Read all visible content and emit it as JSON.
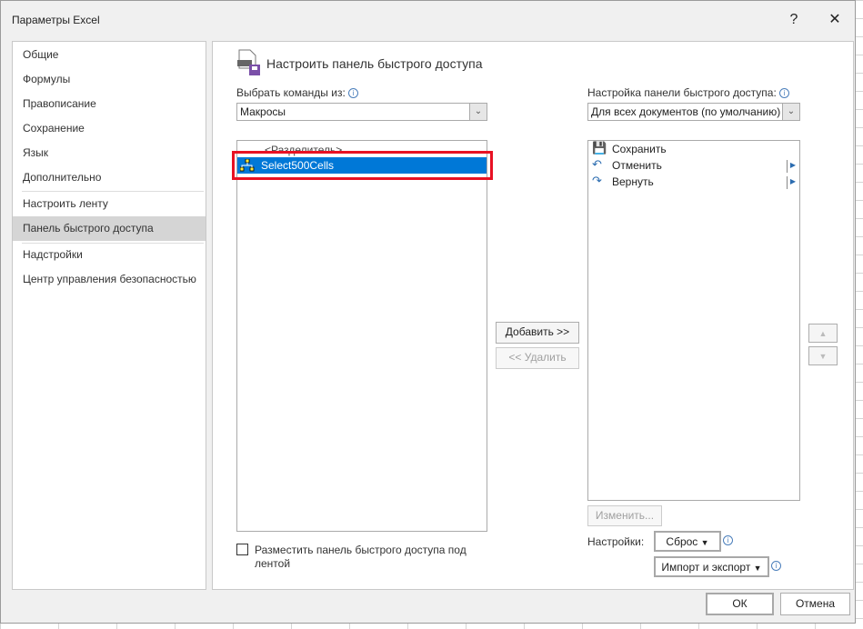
{
  "window": {
    "title": "Параметры Excel",
    "help": "?",
    "close": "✕"
  },
  "sidebar": {
    "items": [
      {
        "label": "Общие"
      },
      {
        "label": "Формулы"
      },
      {
        "label": "Правописание"
      },
      {
        "label": "Сохранение"
      },
      {
        "label": "Язык"
      },
      {
        "label": "Дополнительно"
      },
      {
        "label": "Настроить ленту"
      },
      {
        "label": "Панель быстрого доступа",
        "selected": true
      },
      {
        "label": "Надстройки"
      },
      {
        "label": "Центр управления безопасностью"
      }
    ]
  },
  "main": {
    "heading": "Настроить панель быстрого доступа",
    "choose_label": "Выбрать команды из:",
    "choose_value": "Макросы",
    "commands": [
      {
        "label": "<Разделитель>"
      },
      {
        "label": "Select500Cells",
        "selected": true,
        "icon": "macro-icon"
      }
    ],
    "qat_label": "Настройка панели быстрого доступа:",
    "qat_value": "Для всех документов (по умолчанию)",
    "qat_items": [
      {
        "label": "Сохранить",
        "icon": "save-icon"
      },
      {
        "label": "Отменить",
        "icon": "undo-icon"
      },
      {
        "label": "Вернуть",
        "icon": "redo-icon"
      }
    ],
    "add": "Добавить >>",
    "remove": "<< Удалить",
    "modify": "Изменить...",
    "settings_label": "Настройки:",
    "reset": "Сброс",
    "import_export": "Импорт и экспорт",
    "below_ribbon": "Разместить панель быстрого доступа под лентой",
    "highlight_color": "#e81123",
    "selection_color": "#0078d7"
  },
  "footer": {
    "ok": "ОК",
    "cancel": "Отмена"
  }
}
